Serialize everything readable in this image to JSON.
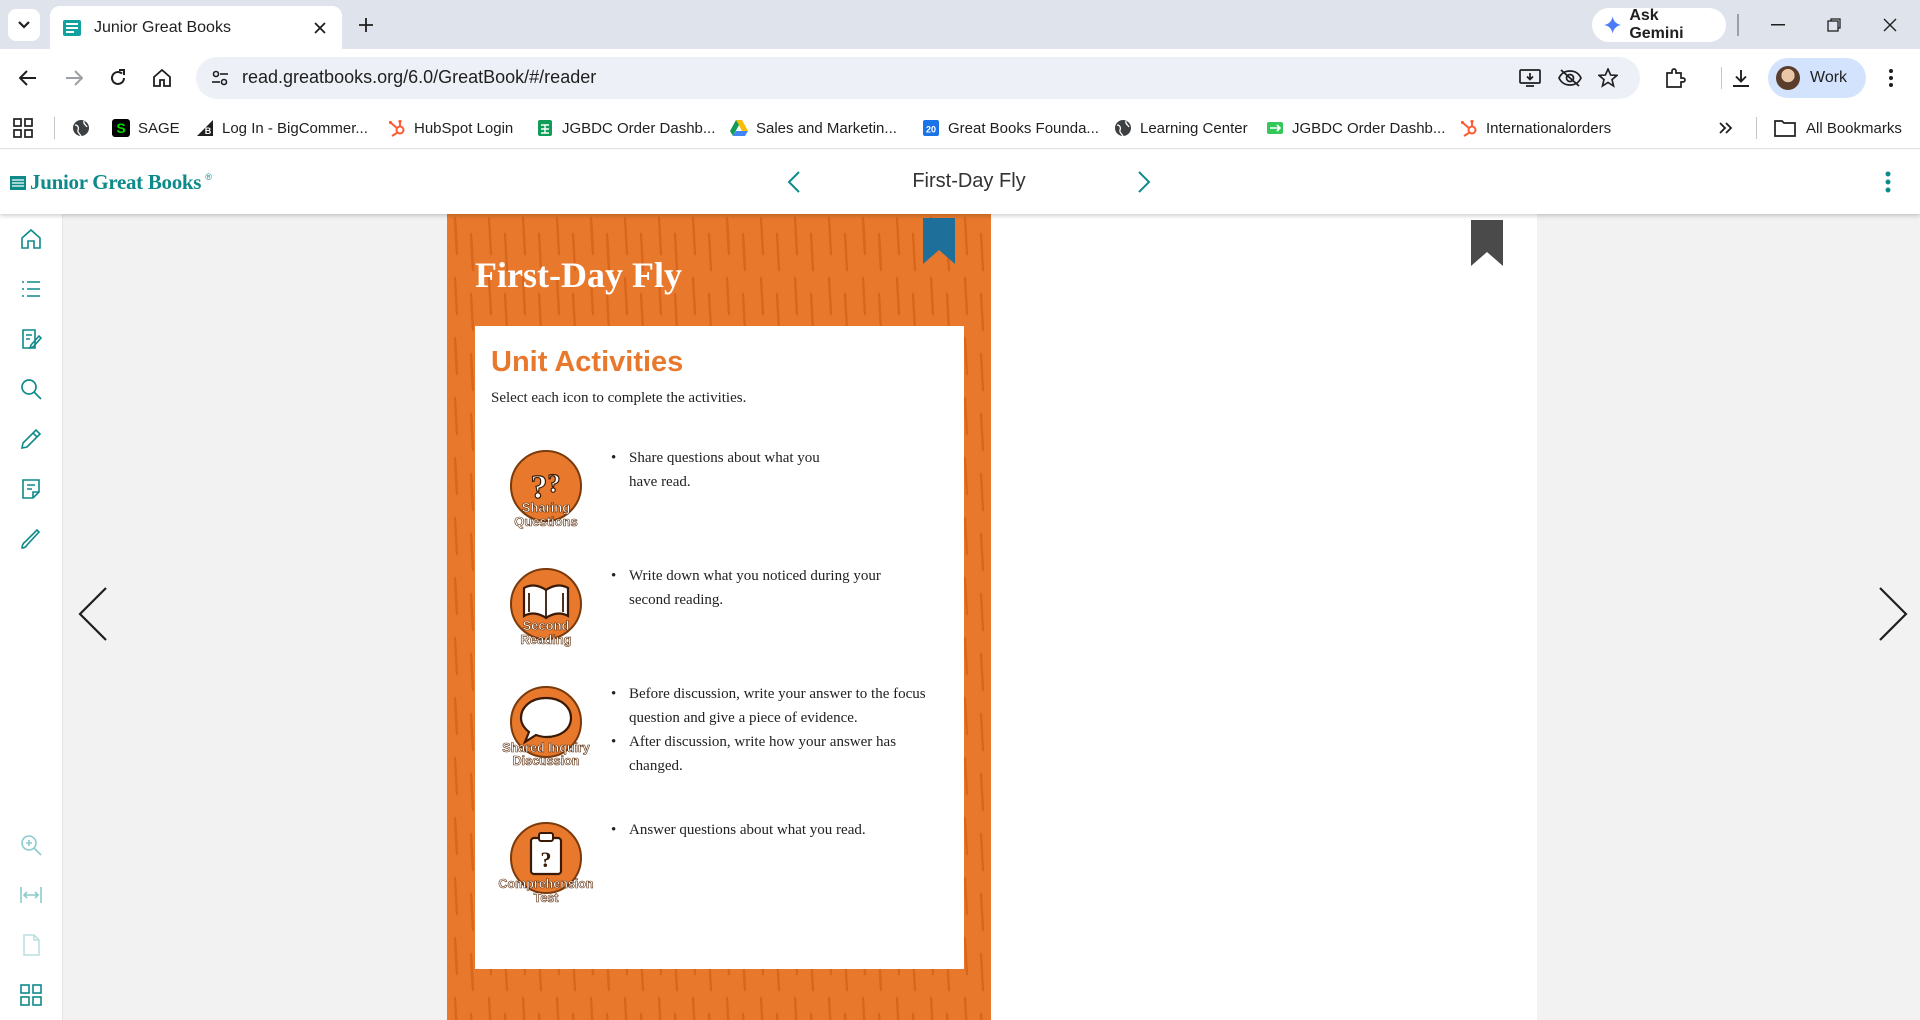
{
  "browser": {
    "tab_title": "Junior Great Books",
    "url": "read.greatbooks.org/6.0/GreatBook/#/reader",
    "gemini_label": "Ask Gemini",
    "profile_label": "Work"
  },
  "bookmarks": [
    {
      "label": "",
      "icon": "globe-icon"
    },
    {
      "label": "SAGE",
      "icon": "sage-icon"
    },
    {
      "label": "Log In - BigCommer...",
      "icon": "bigcommerce-icon"
    },
    {
      "label": "HubSpot Login",
      "icon": "hubspot-icon"
    },
    {
      "label": "JGBDC Order Dashb...",
      "icon": "sheets-icon"
    },
    {
      "label": "Sales and Marketin...",
      "icon": "drive-icon"
    },
    {
      "label": "Great Books Founda...",
      "icon": "calendar-icon"
    },
    {
      "label": "Learning Center",
      "icon": "globe-icon"
    },
    {
      "label": "JGBDC Order Dashb...",
      "icon": "sheets-green-icon"
    },
    {
      "label": "Internationalorders",
      "icon": "hubspot-icon"
    }
  ],
  "all_bookmarks_label": "All Bookmarks",
  "app": {
    "logo_text": "Junior Great Books",
    "logo_mark": "®",
    "book_title": "First-Day Fly"
  },
  "page": {
    "title": "First-Day Fly",
    "heading": "Unit Activities",
    "instruction": "Select each icon to complete the activities.",
    "activities": [
      {
        "icon_line1": "Sharing",
        "icon_line2": "Questions",
        "bullets": [
          "Share questions about what you",
          "have read."
        ]
      },
      {
        "icon_line1": "Second",
        "icon_line2": "Reading",
        "bullets": [
          "Write down what you noticed during your",
          "second reading."
        ]
      },
      {
        "icon_line1": "Shared Inquiry",
        "icon_line2": "Discussion",
        "bullets": [
          "Before discussion, write your answer to the focus question and give a piece of evidence.",
          "After discussion, write how your answer has changed."
        ]
      },
      {
        "icon_line1": "Comprehension",
        "icon_line2": "Test",
        "bullets": [
          "Answer questions about what you read."
        ]
      }
    ]
  },
  "colors": {
    "brand_teal": "#0e8a8a",
    "page_orange": "#e8792c",
    "bookmark_blue": "#1f6f9b",
    "bookmark_gray": "#4a4a4a"
  }
}
